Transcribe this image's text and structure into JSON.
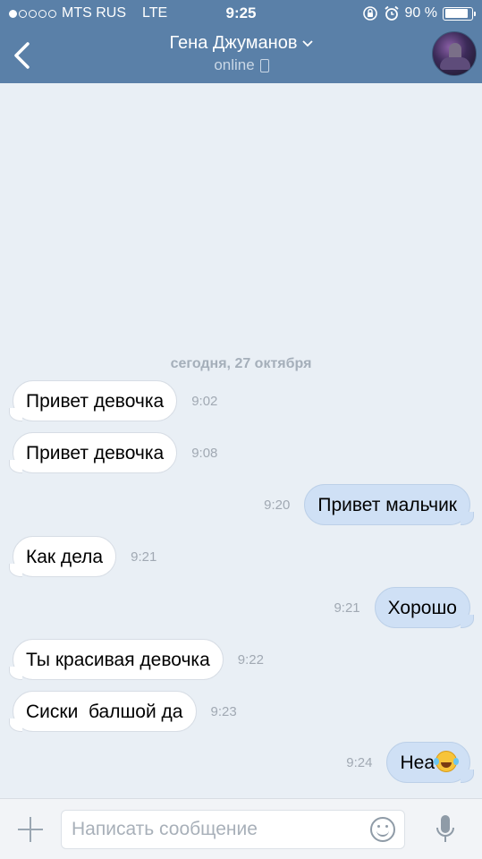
{
  "status_bar": {
    "carrier": "MTS RUS",
    "network": "LTE",
    "time": "9:25",
    "battery_text": "90 %",
    "battery_level": 0.9,
    "signal_bars_filled": 1,
    "signal_bars_total": 5
  },
  "header": {
    "contact_name": "Гена Джуманов",
    "contact_status": "online",
    "back_icon": "chevron-left-icon",
    "colors": {
      "header_bg": "#5a80a8",
      "chat_bg": "#e9eff5",
      "incoming_bubble": "#ffffff",
      "outgoing_bubble": "#cfe0f5"
    }
  },
  "chat": {
    "date_separator": "сегодня, 27 октября",
    "messages": [
      {
        "direction": "in",
        "text": "Привет девочка",
        "time": "9:02"
      },
      {
        "direction": "in",
        "text": "Привет девочка",
        "time": "9:08"
      },
      {
        "direction": "out",
        "text": "Привет мальчик",
        "time": "9:20"
      },
      {
        "direction": "in",
        "text": "Как дела",
        "time": "9:21"
      },
      {
        "direction": "out",
        "text": "Хорошо",
        "time": "9:21"
      },
      {
        "direction": "in",
        "text": "Ты красивая девочка",
        "time": "9:22"
      },
      {
        "direction": "in",
        "text": "Сиски  балшой да",
        "time": "9:23"
      },
      {
        "direction": "out",
        "text": "Неа",
        "time": "9:24",
        "emoji": "face-with-tears-of-joy-icon"
      }
    ]
  },
  "input_bar": {
    "placeholder": "Написать сообщение",
    "value": ""
  }
}
